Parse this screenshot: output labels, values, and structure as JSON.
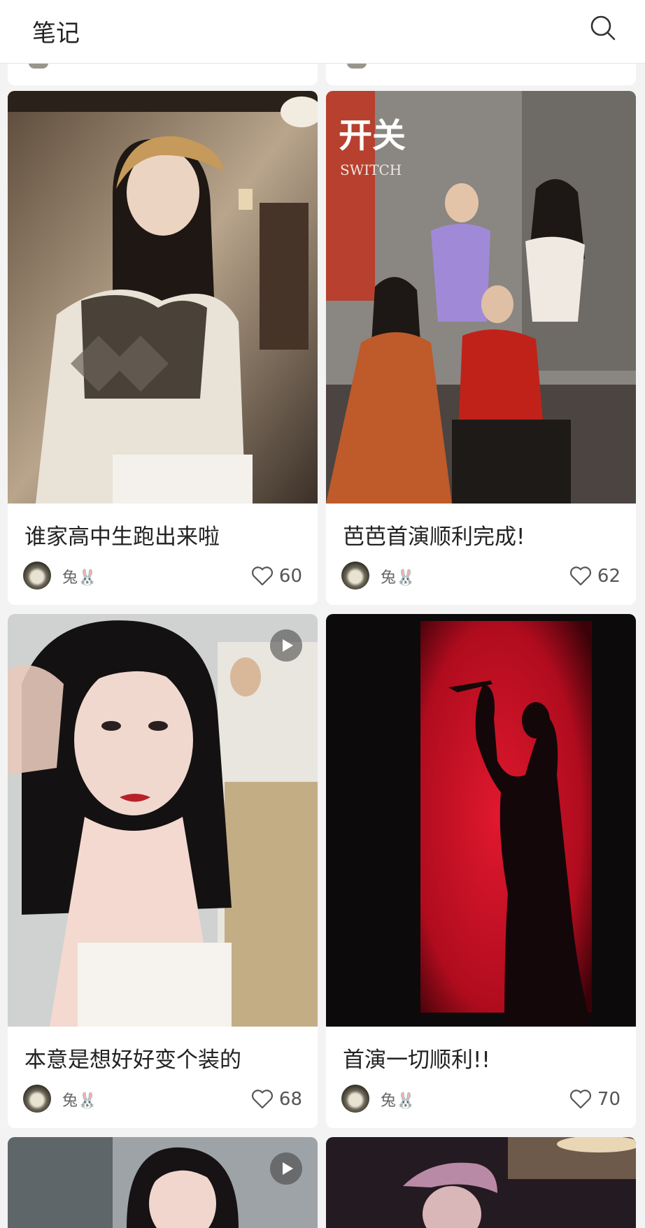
{
  "header": {
    "title": "笔记",
    "search_icon": "search-icon"
  },
  "cards": [
    {
      "caption": "谁家高中生跑出来啦",
      "author": "兔🐰",
      "likes": "60",
      "video": false,
      "image": "girl-beret-cafe-photo"
    },
    {
      "caption": "芭芭首演顺利完成!",
      "author": "兔🐰",
      "likes": "62",
      "video": false,
      "image": "switch-cast-group-photo",
      "poster_text": "开关",
      "poster_subtext": "SWITCH"
    },
    {
      "caption": "本意是想好好变个装的",
      "author": "兔🐰",
      "likes": "68",
      "video": true,
      "image": "girl-selfie-photo"
    },
    {
      "caption": "首演一切顺利!!",
      "author": "兔🐰",
      "likes": "70",
      "video": false,
      "image": "red-silhouette-knife-photo"
    },
    {
      "video": true,
      "image": "girl-partial-photo"
    },
    {
      "video": false,
      "image": "stage-hat-partial-photo"
    }
  ],
  "colors": {
    "stage_red": "#d8102a",
    "card_bg": "#ffffff",
    "page_bg": "#f3f3f3"
  }
}
